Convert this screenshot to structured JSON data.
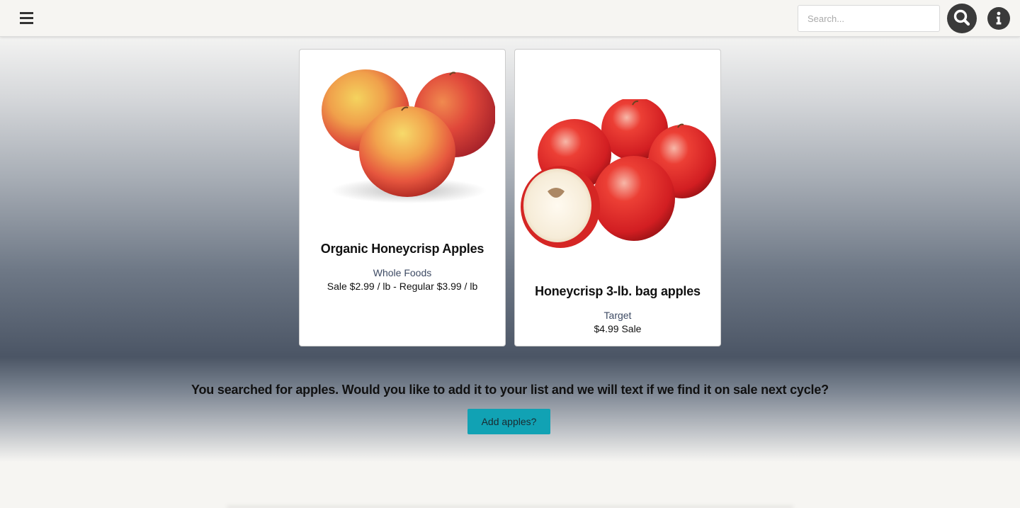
{
  "header": {
    "menu_icon": "hamburger-menu-icon",
    "search_placeholder": "Search...",
    "search_icon": "magnifier-icon",
    "info_icon": "info-icon"
  },
  "results": [
    {
      "title": "Organic Honeycrisp Apples",
      "store": "Whole Foods",
      "price": "Sale $2.99 / lb - Regular $3.99 / lb",
      "image": "three-honeycrisp-apples"
    },
    {
      "title": "Honeycrisp 3-lb. bag apples",
      "store": "Target",
      "price": "$4.99 Sale",
      "image": "red-apples-with-half"
    }
  ],
  "prompt": {
    "text": "You searched for apples. Would you like to add it to your list and we will text if we find it on sale next cycle?",
    "button_label": "Add apples?"
  },
  "colors": {
    "accent": "#11a2b4",
    "store_text": "#3d4a63",
    "icon_bg": "#3a3a3a"
  }
}
